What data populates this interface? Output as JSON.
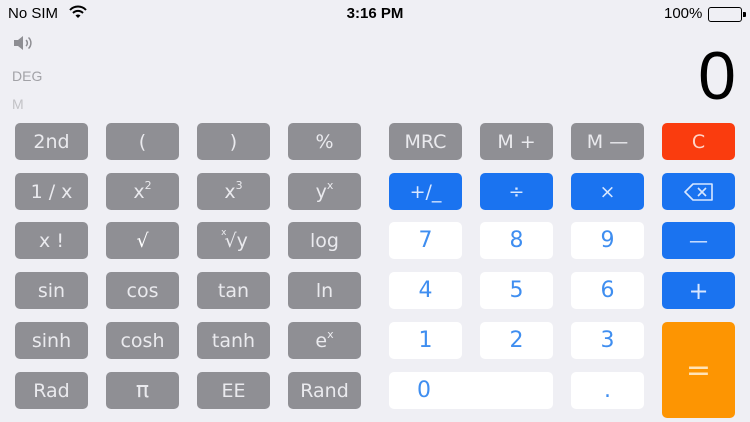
{
  "status_bar": {
    "carrier": "No SIM",
    "time": "3:16 PM",
    "battery_percent": "100%"
  },
  "indicators": {
    "speaker_icon": "speaker-volume-icon",
    "angle_mode": "DEG",
    "memory": "M"
  },
  "display": {
    "value": "0"
  },
  "keys": {
    "second": "2nd",
    "open_paren": "(",
    "close_paren": ")",
    "percent": "%",
    "mrc": "MRC",
    "m_plus": "M +",
    "m_minus": "M —",
    "clear": "C",
    "reciprocal": "1 / x",
    "x_squared_base": "x",
    "x_squared_exp": "2",
    "x_cubed_base": "x",
    "x_cubed_exp": "3",
    "y_pow_base": "y",
    "y_pow_exp": "x",
    "sign": "+/_",
    "divide": "÷",
    "multiply": "×",
    "backspace_icon": "backspace-icon",
    "factorial": "x !",
    "sqrt": "√",
    "root_pre": "x",
    "root_sym": "√y",
    "log": "log",
    "seven": "7",
    "eight": "8",
    "nine": "9",
    "minus": "—",
    "sin": "sin",
    "cos": "cos",
    "tan": "tan",
    "ln": "ln",
    "four": "4",
    "five": "5",
    "six": "6",
    "plus": "+",
    "sinh": "sinh",
    "cosh": "cosh",
    "tanh": "tanh",
    "exp_base": "e",
    "exp_exp": "x",
    "one": "1",
    "two": "2",
    "three": "3",
    "equals": "=",
    "rad": "Rad",
    "pi": "π",
    "ee": "EE",
    "rand": "Rand",
    "zero": "0",
    "decimal": "."
  }
}
